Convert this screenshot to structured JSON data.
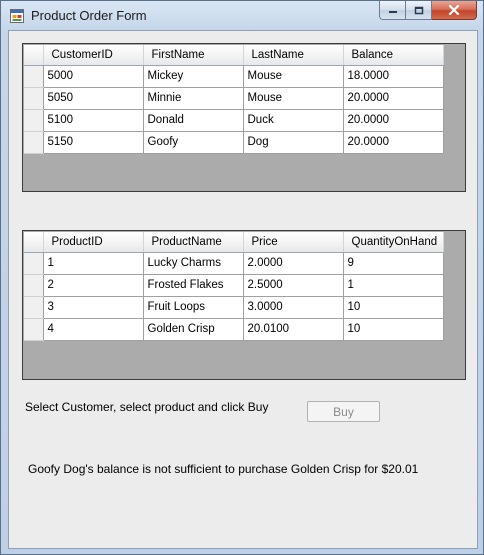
{
  "window": {
    "title": "Product Order Form",
    "icons": {
      "app": "app-form-icon",
      "minimize": "minimize-icon",
      "maximize": "maximize-icon",
      "close": "close-icon"
    }
  },
  "customers_grid": {
    "columns": [
      "CustomerID",
      "FirstName",
      "LastName",
      "Balance"
    ],
    "rows": [
      [
        "5000",
        "Mickey",
        "Mouse",
        "18.0000"
      ],
      [
        "5050",
        "Minnie",
        "Mouse",
        "20.0000"
      ],
      [
        "5100",
        "Donald",
        "Duck",
        "20.0000"
      ],
      [
        "5150",
        "Goofy",
        "Dog",
        "20.0000"
      ]
    ]
  },
  "products_grid": {
    "columns": [
      "ProductID",
      "ProductName",
      "Price",
      "QuantityOnHand"
    ],
    "rows": [
      [
        "1",
        "Lucky Charms",
        "2.0000",
        "9"
      ],
      [
        "2",
        "Frosted Flakes",
        "2.5000",
        "1"
      ],
      [
        "3",
        "Fruit Loops",
        "3.0000",
        "10"
      ],
      [
        "4",
        "Golden Crisp",
        "20.0100",
        "10"
      ]
    ]
  },
  "instruction_label": "Select Customer, select product and click Buy",
  "buy_button": {
    "label": "Buy",
    "enabled": false
  },
  "status_message": "Goofy Dog's balance is not sufficient to purchase Golden Crisp for $20.01",
  "colors": {
    "grid_background": "#ababab",
    "client_background": "#ececec",
    "close_button": "#c3452b"
  }
}
